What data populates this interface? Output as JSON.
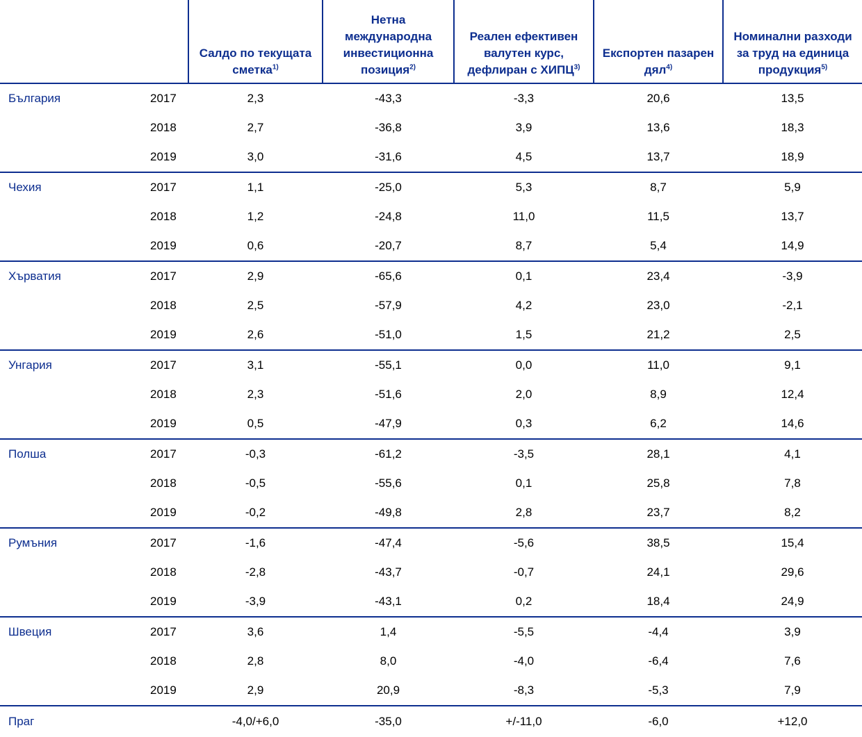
{
  "headers": {
    "current_account": {
      "text": "Салдо по текущата сметка",
      "note": "1)"
    },
    "niip": {
      "text": "Нетна международна инвестиционна позиция",
      "note": "2)"
    },
    "reer": {
      "text": "Реален ефективен валутен курс, дефлиран с ХИПЦ",
      "note": "3)"
    },
    "export_share": {
      "text": "Експортен пазарен дял",
      "note": "4)"
    },
    "ulc": {
      "text": "Номинални разходи за труд на единица продукция",
      "note": "5)"
    }
  },
  "countries": [
    {
      "name": "България",
      "rows": [
        {
          "year": "2017",
          "values": [
            "2,3",
            "-43,3",
            "-3,3",
            "20,6",
            "13,5"
          ]
        },
        {
          "year": "2018",
          "values": [
            "2,7",
            "-36,8",
            "3,9",
            "13,6",
            "18,3"
          ]
        },
        {
          "year": "2019",
          "values": [
            "3,0",
            "-31,6",
            "4,5",
            "13,7",
            "18,9"
          ]
        }
      ]
    },
    {
      "name": "Чехия",
      "rows": [
        {
          "year": "2017",
          "values": [
            "1,1",
            "-25,0",
            "5,3",
            "8,7",
            "5,9"
          ]
        },
        {
          "year": "2018",
          "values": [
            "1,2",
            "-24,8",
            "11,0",
            "11,5",
            "13,7"
          ]
        },
        {
          "year": "2019",
          "values": [
            "0,6",
            "-20,7",
            "8,7",
            "5,4",
            "14,9"
          ]
        }
      ]
    },
    {
      "name": "Хърватия",
      "rows": [
        {
          "year": "2017",
          "values": [
            "2,9",
            "-65,6",
            "0,1",
            "23,4",
            "-3,9"
          ]
        },
        {
          "year": "2018",
          "values": [
            "2,5",
            "-57,9",
            "4,2",
            "23,0",
            "-2,1"
          ]
        },
        {
          "year": "2019",
          "values": [
            "2,6",
            "-51,0",
            "1,5",
            "21,2",
            "2,5"
          ]
        }
      ]
    },
    {
      "name": "Унгария",
      "rows": [
        {
          "year": "2017",
          "values": [
            "3,1",
            "-55,1",
            "0,0",
            "11,0",
            "9,1"
          ]
        },
        {
          "year": "2018",
          "values": [
            "2,3",
            "-51,6",
            "2,0",
            "8,9",
            "12,4"
          ]
        },
        {
          "year": "2019",
          "values": [
            "0,5",
            "-47,9",
            "0,3",
            "6,2",
            "14,6"
          ]
        }
      ]
    },
    {
      "name": "Полша",
      "rows": [
        {
          "year": "2017",
          "values": [
            "-0,3",
            "-61,2",
            "-3,5",
            "28,1",
            "4,1"
          ]
        },
        {
          "year": "2018",
          "values": [
            "-0,5",
            "-55,6",
            "0,1",
            "25,8",
            "7,8"
          ]
        },
        {
          "year": "2019",
          "values": [
            "-0,2",
            "-49,8",
            "2,8",
            "23,7",
            "8,2"
          ]
        }
      ]
    },
    {
      "name": "Румъния",
      "rows": [
        {
          "year": "2017",
          "values": [
            "-1,6",
            "-47,4",
            "-5,6",
            "38,5",
            "15,4"
          ]
        },
        {
          "year": "2018",
          "values": [
            "-2,8",
            "-43,7",
            "-0,7",
            "24,1",
            "29,6"
          ]
        },
        {
          "year": "2019",
          "values": [
            "-3,9",
            "-43,1",
            "0,2",
            "18,4",
            "24,9"
          ]
        }
      ]
    },
    {
      "name": "Швеция",
      "rows": [
        {
          "year": "2017",
          "values": [
            "3,6",
            "1,4",
            "-5,5",
            "-4,4",
            "3,9"
          ]
        },
        {
          "year": "2018",
          "values": [
            "2,8",
            "8,0",
            "-4,0",
            "-6,4",
            "7,6"
          ]
        },
        {
          "year": "2019",
          "values": [
            "2,9",
            "20,9",
            "-8,3",
            "-5,3",
            "7,9"
          ]
        }
      ]
    }
  ],
  "threshold": {
    "label": "Праг",
    "values": [
      "-4,0/+6,0",
      "-35,0",
      "+/-11,0",
      "-6,0",
      "+12,0"
    ]
  },
  "colors": {
    "accent": "#0d2e8f",
    "text": "#000000",
    "background": "#ffffff"
  }
}
